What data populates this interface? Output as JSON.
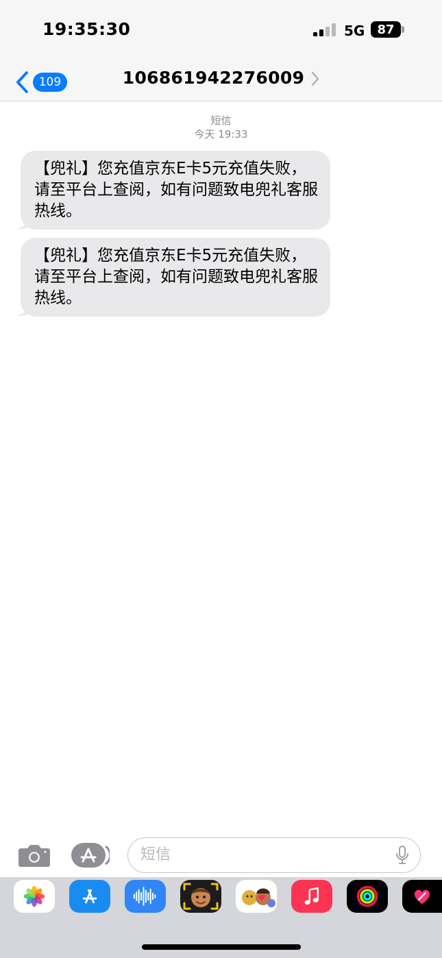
{
  "status_bar": {
    "time": "19:35:30",
    "network": "5G",
    "battery": "87"
  },
  "nav": {
    "back_badge": "109",
    "title": "106861942276009"
  },
  "conversation": {
    "service_label": "短信",
    "timestamp": "今天 19:33",
    "messages": [
      {
        "text": "【兜礼】您充值京东E卡5元充值失败，请至平台上查阅，如有问题致电兜礼客服热线。"
      },
      {
        "text": "【兜礼】您充值京东E卡5元充值失败，请至平台上查阅，如有问题致电兜礼客服热线。"
      }
    ]
  },
  "compose": {
    "placeholder": "短信"
  },
  "app_strip": {
    "apps": [
      {
        "icon": "photos-icon"
      },
      {
        "icon": "app-store-icon"
      },
      {
        "icon": "audio-message-icon"
      },
      {
        "icon": "memoji-icon"
      },
      {
        "icon": "animoji-stickers-icon"
      },
      {
        "icon": "music-icon"
      },
      {
        "icon": "fitness-activity-icon"
      },
      {
        "icon": "digital-touch-icon"
      }
    ]
  },
  "colors": {
    "accent_blue": "#0a7cff",
    "bubble_gray": "#e9e9eb",
    "bar_gray": "#f6f6f6",
    "strip_gray": "#d4d6db"
  }
}
